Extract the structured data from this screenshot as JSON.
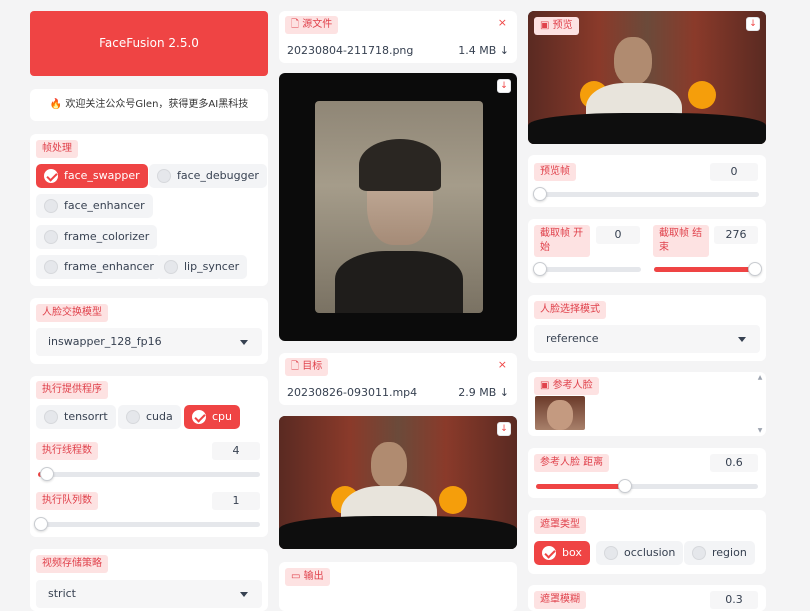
{
  "header": {
    "title": "FaceFusion 2.5.0",
    "notice_icon": "fire-icon",
    "notice": "欢迎关注公众号Glen，获得更多AI黑科技"
  },
  "frame_processors": {
    "label": "帧处理",
    "options": [
      "face_swapper",
      "face_debugger",
      "face_enhancer",
      "frame_colorizer",
      "frame_enhancer",
      "lip_syncer"
    ],
    "selected": [
      "face_swapper"
    ]
  },
  "face_swapper_model": {
    "label": "人脸交换模型",
    "value": "inswapper_128_fp16"
  },
  "execution_providers": {
    "label": "执行提供程序",
    "options": [
      "tensorrt",
      "cuda",
      "cpu"
    ],
    "selected": [
      "cpu"
    ]
  },
  "execution_thread_count": {
    "label": "执行线程数",
    "value": "4",
    "fraction": 0.04
  },
  "execution_queue_count": {
    "label": "执行队列数",
    "value": "1",
    "fraction": 0.0
  },
  "video_memory_strategy": {
    "label": "视频存储策略",
    "value": "strict"
  },
  "source": {
    "label": "源文件",
    "icon": "file-icon",
    "file_name": "20230804-211718.png",
    "file_size": "1.4 MB ↓"
  },
  "target": {
    "label": "目标",
    "icon": "file-icon",
    "file_name": "20230826-093011.mp4",
    "file_size": "2.9 MB ↓"
  },
  "output": {
    "label": "输出",
    "icon": "video-icon"
  },
  "preview": {
    "label": "预览",
    "icon": "image-icon"
  },
  "preview_frame": {
    "label": "预览帧",
    "value": "0",
    "fraction": 0.0
  },
  "trim_frame": {
    "start_label": "截取帧 开始",
    "start_value": "0",
    "end_label": "截取帧 结束",
    "end_value": "276",
    "start_fraction": 0.0,
    "end_fraction": 1.0
  },
  "face_selector_mode": {
    "label": "人脸选择模式",
    "value": "reference"
  },
  "reference_face": {
    "label": "参考人脸",
    "icon": "image-icon"
  },
  "reference_face_distance": {
    "label": "参考人脸 距离",
    "value": "0.6",
    "fraction": 0.4
  },
  "face_mask_types": {
    "label": "遮罩类型",
    "options": [
      "box",
      "occlusion",
      "region"
    ],
    "selected": [
      "box"
    ]
  },
  "face_mask_blur": {
    "label": "遮罩模糊",
    "value": "0.3"
  },
  "colors": {
    "accent": "#ef4444",
    "accent_light": "#fde2e2",
    "background": "#f4f4f5"
  }
}
